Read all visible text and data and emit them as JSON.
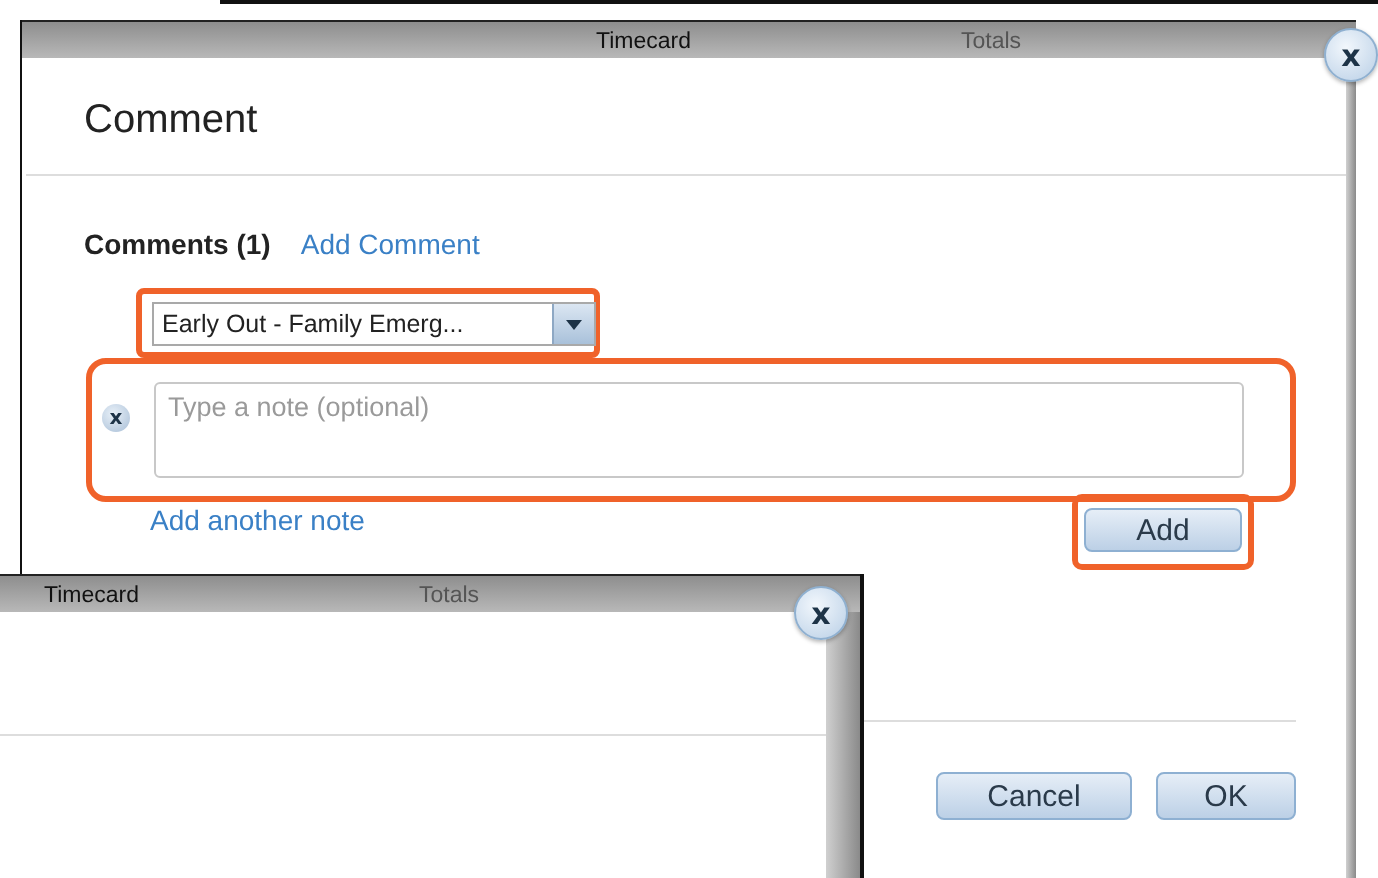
{
  "comment_dialog": {
    "header_tabs": [
      {
        "label": "Timecard",
        "disabled": false
      },
      {
        "label": "Totals",
        "disabled": true
      }
    ],
    "close": "x",
    "title": "Comment",
    "comments_label": "Comments (1)",
    "add_comment_link": "Add Comment",
    "reason_dropdown": {
      "value": "Early Out - Family Emerg...",
      "highlighted": true
    },
    "note": {
      "remove": "x",
      "placeholder": "Type a note (optional)",
      "highlighted": true
    },
    "add_another_note": "Add another note",
    "add_button": {
      "label": "Add",
      "highlighted": true
    },
    "buttons": [
      "Cancel",
      "OK"
    ]
  },
  "second_dialog": {
    "header_tabs": [
      {
        "label": "Timecard",
        "disabled": false
      },
      {
        "label": "Totals",
        "disabled": true
      }
    ],
    "close": "x"
  }
}
